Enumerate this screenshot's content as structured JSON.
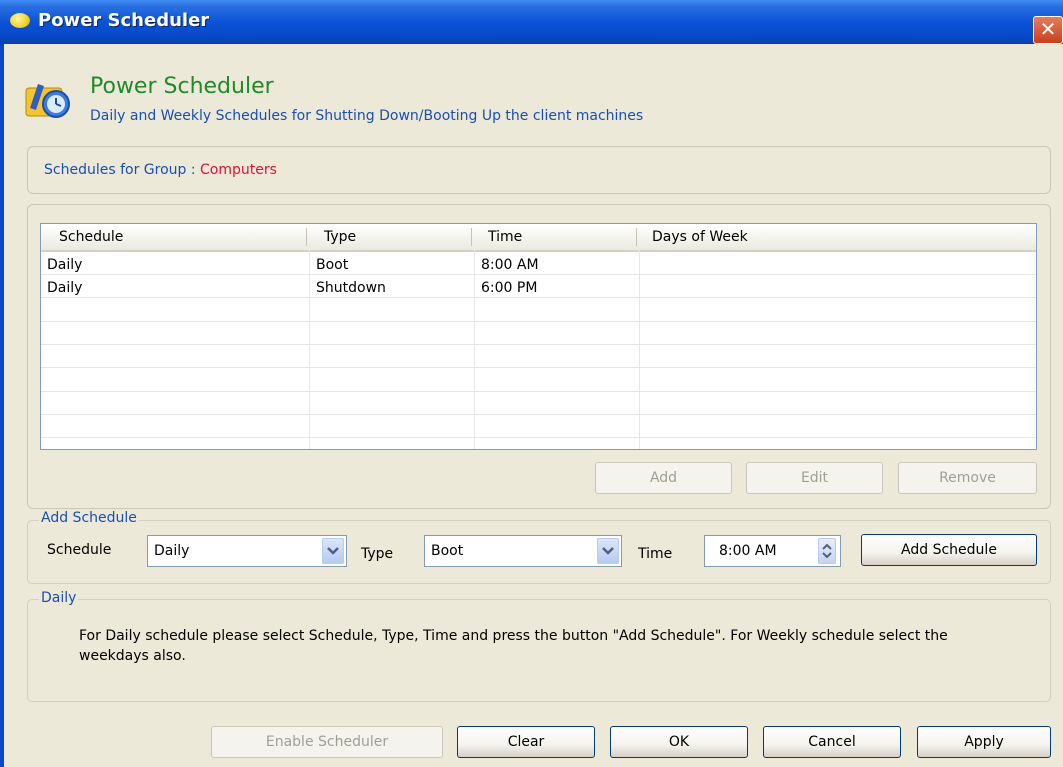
{
  "window": {
    "title": "Power Scheduler",
    "close_glyph": "✕"
  },
  "header": {
    "title": "Power Scheduler",
    "subtitle": "Daily and Weekly Schedules for Shutting Down/Booting Up the client machines",
    "icon": "power-scheduler-icon"
  },
  "group": {
    "label": "Schedules for Group :",
    "value": "Computers"
  },
  "table": {
    "columns": [
      "Schedule",
      "Type",
      "Time",
      "Days of Week"
    ],
    "rows": [
      {
        "schedule": "Daily",
        "type": "Boot",
        "time": "8:00 AM",
        "days": ""
      },
      {
        "schedule": "Daily",
        "type": "Shutdown",
        "time": "6:00 PM",
        "days": ""
      }
    ]
  },
  "list_buttons": {
    "add": "Add",
    "edit": "Edit",
    "remove": "Remove"
  },
  "add_schedule": {
    "legend": "Add Schedule",
    "schedule_label": "Schedule",
    "schedule_value": "Daily",
    "type_label": "Type",
    "type_value": "Boot",
    "time_label": "Time",
    "time_value": "8:00 AM",
    "button": "Add Schedule"
  },
  "info": {
    "legend": "Daily",
    "text": "For Daily schedule please select Schedule, Type, Time and press the button \"Add Schedule\". For Weekly schedule select the weekdays also."
  },
  "footer": {
    "enable": "Enable Scheduler",
    "clear": "Clear",
    "ok": "OK",
    "cancel": "Cancel",
    "apply": "Apply"
  },
  "colors": {
    "title_bar": "#0A53D8",
    "header_title": "#208A28",
    "link_blue": "#1A4FB0",
    "group_value": "#E0103A"
  }
}
